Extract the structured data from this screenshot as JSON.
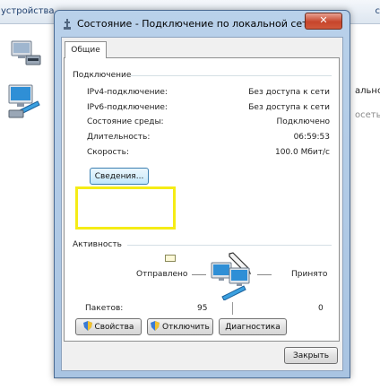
{
  "background": {
    "toolbar_left": "устройства",
    "toolbar_right": "с",
    "labels": [
      "альной",
      "осеть"
    ]
  },
  "dialog": {
    "title": "Состояние - Подключение по локальной сети",
    "close_label": "✕",
    "tab": "Общие",
    "connection": {
      "group_title": "Подключение",
      "rows": [
        {
          "label": "IPv4-подключение:",
          "value": "Без доступа к сети"
        },
        {
          "label": "IPv6-подключение:",
          "value": "Без доступа к сети"
        },
        {
          "label": "Состояние среды:",
          "value": "Подключено"
        },
        {
          "label": "Длительность:",
          "value": "06:59:53"
        },
        {
          "label": "Скорость:",
          "value": "100.0 Мбит/с"
        }
      ],
      "details_button": "Сведения..."
    },
    "activity": {
      "group_title": "Активность",
      "sent_label": "Отправлено",
      "received_label": "Принято",
      "packets_label": "Пакетов:",
      "packets_sent": "95",
      "packets_received": "0"
    },
    "buttons": {
      "properties": "Свойства",
      "disable": "Отключить",
      "diagnose": "Диагностика",
      "close": "Закрыть"
    }
  },
  "colors": {
    "highlight": "#f5ec16",
    "titlebar": "#b9d1ea",
    "close_button": "#c7452b"
  },
  "icons": [
    "network-adapter-icon",
    "network-connection-icon",
    "network-activity-icon",
    "shield-icon",
    "pen-cursor-icon"
  ]
}
